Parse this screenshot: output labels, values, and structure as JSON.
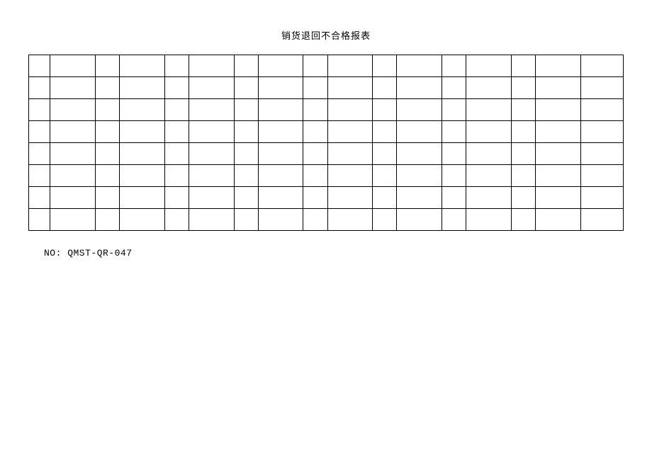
{
  "title": "销货退回不合格报表",
  "footer": "NO: QMST-QR-047",
  "table": {
    "rows": 8,
    "cols": 17,
    "cells": [
      [
        "",
        "",
        "",
        "",
        "",
        "",
        "",
        "",
        "",
        "",
        "",
        "",
        "",
        "",
        "",
        "",
        ""
      ],
      [
        "",
        "",
        "",
        "",
        "",
        "",
        "",
        "",
        "",
        "",
        "",
        "",
        "",
        "",
        "",
        "",
        ""
      ],
      [
        "",
        "",
        "",
        "",
        "",
        "",
        "",
        "",
        "",
        "",
        "",
        "",
        "",
        "",
        "",
        "",
        ""
      ],
      [
        "",
        "",
        "",
        "",
        "",
        "",
        "",
        "",
        "",
        "",
        "",
        "",
        "",
        "",
        "",
        "",
        ""
      ],
      [
        "",
        "",
        "",
        "",
        "",
        "",
        "",
        "",
        "",
        "",
        "",
        "",
        "",
        "",
        "",
        "",
        ""
      ],
      [
        "",
        "",
        "",
        "",
        "",
        "",
        "",
        "",
        "",
        "",
        "",
        "",
        "",
        "",
        "",
        "",
        ""
      ],
      [
        "",
        "",
        "",
        "",
        "",
        "",
        "",
        "",
        "",
        "",
        "",
        "",
        "",
        "",
        "",
        "",
        ""
      ],
      [
        "",
        "",
        "",
        "",
        "",
        "",
        "",
        "",
        "",
        "",
        "",
        "",
        "",
        "",
        "",
        "",
        ""
      ]
    ]
  }
}
